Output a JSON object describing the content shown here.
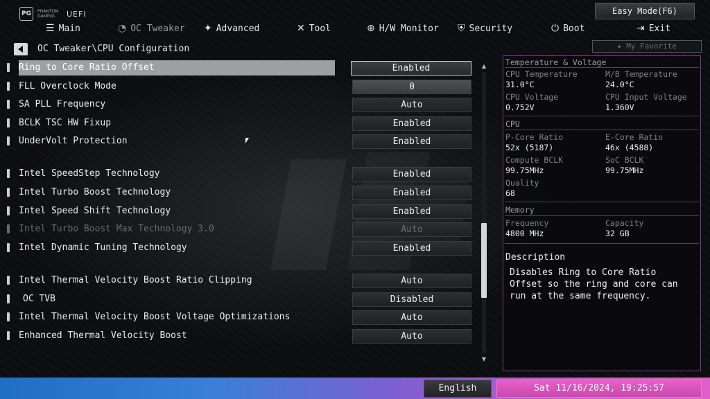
{
  "header": {
    "brand_badge": "PG",
    "brand_sub": "PHANTOM GAMING",
    "brand_uefi": "UEFI",
    "easy_mode": "Easy Mode(F6)"
  },
  "menu": [
    {
      "label": "Main",
      "icon": "list-icon"
    },
    {
      "label": "OC Tweaker",
      "icon": "gauge-icon"
    },
    {
      "label": "Advanced",
      "icon": "star-icon"
    },
    {
      "label": "Tool",
      "icon": "tools-icon"
    },
    {
      "label": "H/W Monitor",
      "icon": "crosshair-icon"
    },
    {
      "label": "Security",
      "icon": "shield-icon"
    },
    {
      "label": "Boot",
      "icon": "power-icon"
    },
    {
      "label": "Exit",
      "icon": "exit-icon"
    }
  ],
  "breadcrumb": "OC Tweaker\\CPU Configuration",
  "favorite": "My Favorite",
  "settings": [
    {
      "label": "Ring to Core Ratio Offset",
      "value": "Enabled"
    },
    {
      "label": "FLL Overclock Mode",
      "value": "0"
    },
    {
      "label": "SA PLL Frequency",
      "value": "Auto"
    },
    {
      "label": "BCLK TSC HW Fixup",
      "value": "Enabled"
    },
    {
      "label": "UnderVolt Protection",
      "value": "Enabled"
    },
    {
      "label": "Intel SpeedStep Technology",
      "value": "Enabled"
    },
    {
      "label": "Intel Turbo Boost Technology",
      "value": "Enabled"
    },
    {
      "label": "Intel Speed Shift Technology",
      "value": "Enabled"
    },
    {
      "label": "Intel Turbo Boost Max Technology 3.0",
      "value": "Auto"
    },
    {
      "label": "Intel Dynamic Tuning Technology",
      "value": "Enabled"
    },
    {
      "label": "Intel Thermal Velocity Boost Ratio Clipping",
      "value": "Auto"
    },
    {
      "label": "OC TVB",
      "value": "Disabled"
    },
    {
      "label": "Intel Thermal Velocity Boost Voltage Optimizations",
      "value": "Auto"
    },
    {
      "label": "Enhanced Thermal Velocity Boost",
      "value": "Auto"
    }
  ],
  "panel": {
    "temp_title": "Temperature & Voltage",
    "cpu_temp_label": "CPU Temperature",
    "cpu_temp_value": "31.0°C",
    "mb_temp_label": "M/B Temperature",
    "mb_temp_value": "24.0°C",
    "cpu_volt_label": "CPU Voltage",
    "cpu_volt_value": "0.752V",
    "cpu_in_volt_label": "CPU Input Voltage",
    "cpu_in_volt_value": "1.360V",
    "cpu_title": "CPU",
    "pcore_label": "P-Core Ratio",
    "pcore_value": "52x (5187)",
    "ecore_label": "E-Core Ratio",
    "ecore_value": "46x (4588)",
    "cbclk_label": "Compute BCLK",
    "cbclk_value": "99.75MHz",
    "socbclk_label": "SoC BCLK",
    "socbclk_value": "99.75MHz",
    "quality_label": "Quality",
    "quality_value": "68",
    "mem_title": "Memory",
    "freq_label": "Frequency",
    "freq_value": "4800 MHz",
    "cap_label": "Capacity",
    "cap_value": "32 GB",
    "desc_title": "Description",
    "desc_body": "Disables Ring to Core Ratio Offset so the ring and core can run at the same frequency."
  },
  "footer": {
    "language": "English",
    "datetime": "Sat 11/16/2024, 19:25:57"
  },
  "colors": {
    "panel_border": "#7a3c8e",
    "footer_left": "#1e6fc4",
    "footer_right": "#e05fc8",
    "clock_bg": "#e85fc6"
  }
}
